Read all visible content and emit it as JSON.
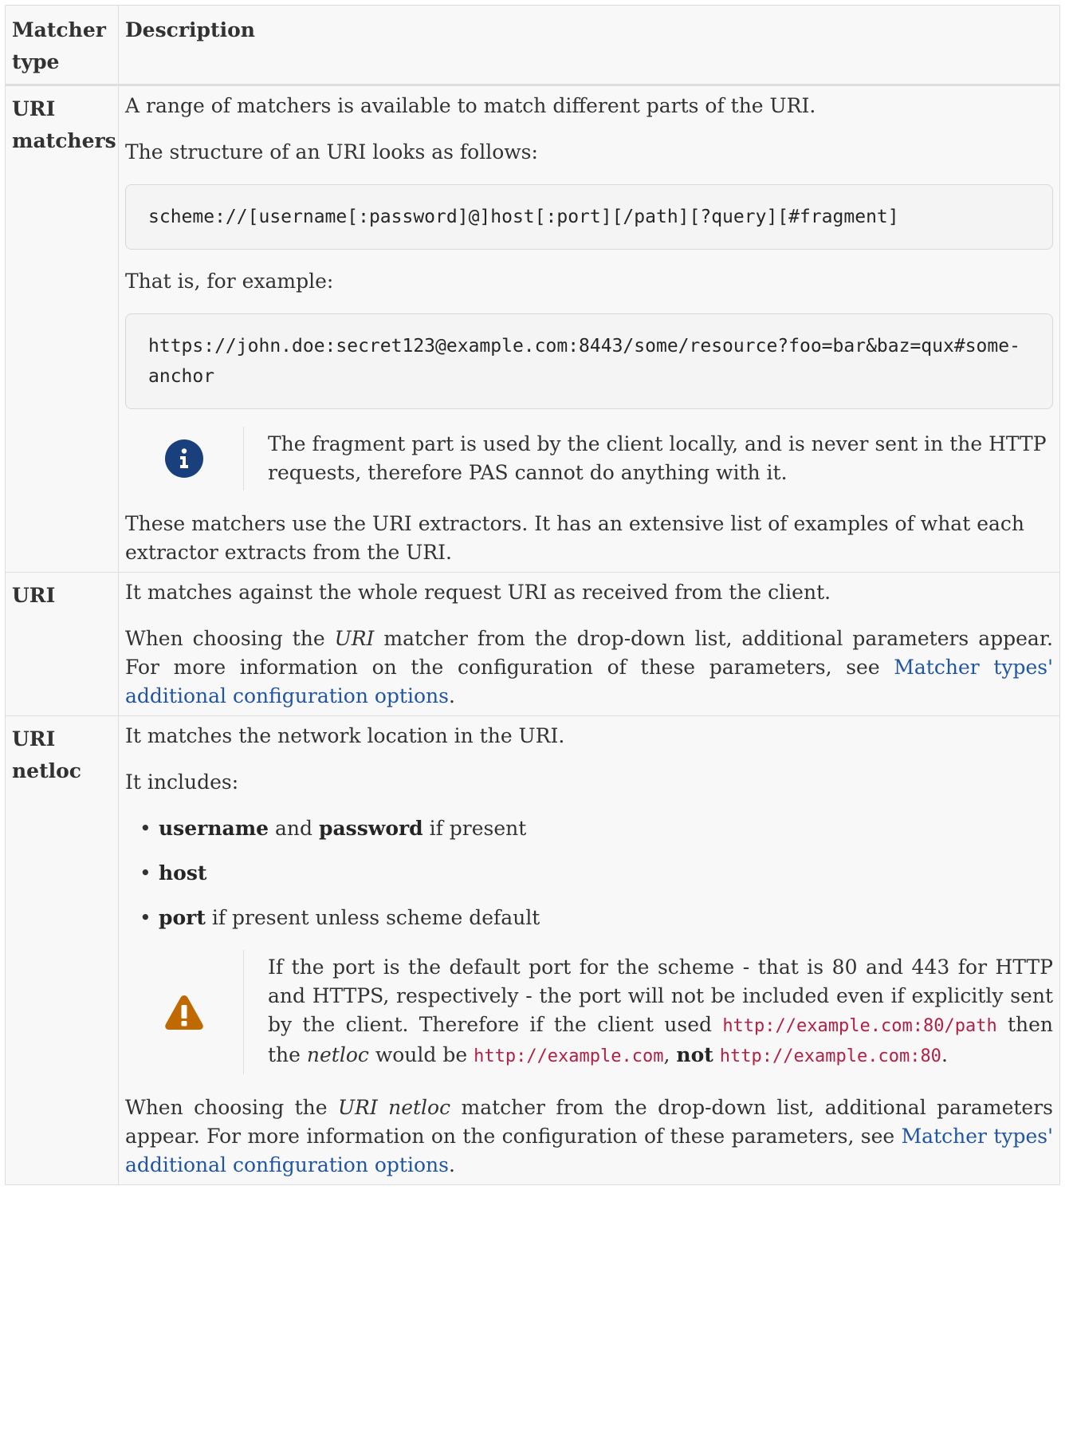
{
  "table": {
    "headers": {
      "type": "Matcher type",
      "description": "Description"
    },
    "rows": [
      {
        "type": "URI matchers",
        "p1": "A range of matchers is available to match different parts of the URI.",
        "p2": "The structure of an URI looks as follows:",
        "code1": "scheme://[username[:password]@]host[:port][/path][?query][#fragment]",
        "p3": "That is, for example:",
        "code2": "https://john.doe:secret123@example.com:8443/some/resource?foo=bar&baz=qux#some-anchor",
        "note": {
          "icon": "info-icon",
          "text": "The fragment part is used by the client locally, and is never sent in the HTTP requests, therefore PAS cannot do anything with it."
        },
        "p4": "These matchers use the URI extractors. It has an extensive list of examples of what each extractor extracts from the URI."
      },
      {
        "type": "URI",
        "p1": "It matches against the whole request URI as received from the client.",
        "p2_before": "When choosing the ",
        "p2_em": "URI",
        "p2_after": " matcher from the drop-down list, additional parameters appear. For more information on the configuration of these parameters, see ",
        "link": "Matcher types' additional configuration options",
        "p2_end": "."
      },
      {
        "type": "URI netloc",
        "p1": "It matches the network location in the URI.",
        "p2": "It includes:",
        "items": [
          {
            "bold1": "username",
            "mid": " and ",
            "bold2": "password",
            "rest": " if present"
          },
          {
            "bold1": "host",
            "mid": "",
            "bold2": "",
            "rest": ""
          },
          {
            "bold1": "port",
            "mid": "",
            "bold2": "",
            "rest": " if present unless scheme default"
          }
        ],
        "warning": {
          "icon": "warning-icon",
          "t1": "If the port is the default port for the scheme - that is 80 and 443 for HTTP and HTTPS, respectively - the port will not be included even if explicitly sent by the client. Therefore if the client used ",
          "code1": "http://example.com:80/path",
          "t2": " then the ",
          "em": "netloc",
          "t3": " would be ",
          "code2": "http://example.com",
          "t4": ", ",
          "bold": "not",
          "t5": " ",
          "code3": "http://example.com:80",
          "t6": "."
        },
        "p3_before": "When choosing the ",
        "p3_em": "URI netloc",
        "p3_after": " matcher from the drop-down list, additional parameters appear. For more information on the configuration of these parameters, see ",
        "link": "Matcher types' additional configuration options",
        "p3_end": "."
      }
    ]
  },
  "colors": {
    "link": "#2156a5",
    "inline_code": "#b12146",
    "info_icon": "#19407c",
    "warning_icon": "#bf6900"
  }
}
